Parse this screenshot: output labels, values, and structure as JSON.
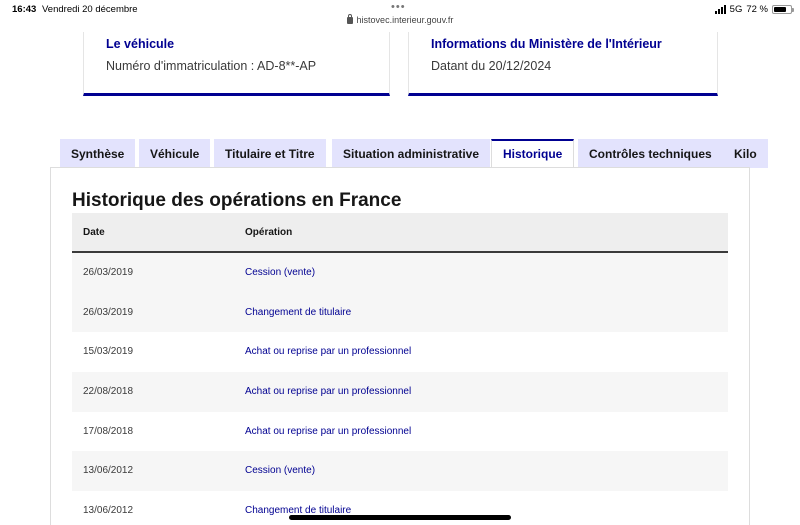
{
  "status_bar": {
    "time": "16:43",
    "date": "Vendredi 20 décembre",
    "url": "histovec.interieur.gouv.fr",
    "network": "5G",
    "battery": "72 %",
    "battery_level": 0.72
  },
  "cards": [
    {
      "title": "Le véhicule",
      "text": "Numéro d'immatriculation : AD-8**-AP"
    },
    {
      "title": "Informations du Ministère de l'Intérieur",
      "text": "Datant du 20/12/2024"
    }
  ],
  "tabs": [
    {
      "label": "Synthèse",
      "active": false
    },
    {
      "label": "Véhicule",
      "active": false
    },
    {
      "label": "Titulaire et Titre",
      "active": false
    },
    {
      "label": "Situation administrative",
      "active": false
    },
    {
      "label": "Historique",
      "active": true
    },
    {
      "label": "Contrôles techniques",
      "active": false
    },
    {
      "label": "Kilo",
      "active": false
    }
  ],
  "section": {
    "title": "Historique des opérations en France"
  },
  "table": {
    "columns": [
      "Date",
      "Opération"
    ],
    "rows": [
      {
        "date": "26/03/2019",
        "operation": "Cession (vente)"
      },
      {
        "date": "26/03/2019",
        "operation": "Changement de titulaire"
      },
      {
        "date": "15/03/2019",
        "operation": "Achat ou reprise par un professionnel"
      },
      {
        "date": "22/08/2018",
        "operation": "Achat ou reprise par un professionnel"
      },
      {
        "date": "17/08/2018",
        "operation": "Achat ou reprise par un professionnel"
      },
      {
        "date": "13/06/2012",
        "operation": "Cession (vente)"
      },
      {
        "date": "13/06/2012",
        "operation": "Changement de titulaire"
      }
    ]
  },
  "colors": {
    "primary": "#000091",
    "tab_background": "#e3e3fd",
    "row_alt": "#f6f6f6"
  }
}
